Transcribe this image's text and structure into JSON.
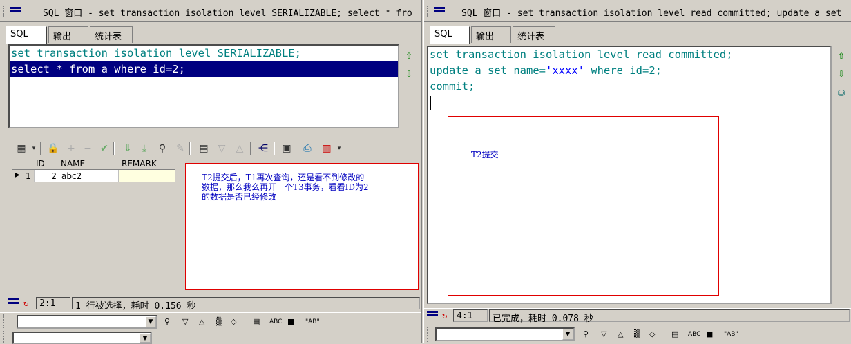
{
  "left": {
    "title": "SQL 窗口 - set transaction isolation level SERIALIZABLE; select * fro",
    "tabs": [
      "SQL",
      "输出",
      "统计表"
    ],
    "sql_lines": [
      {
        "kw1": "set transaction isolation level",
        "rest": " SERIALIZABLE;"
      },
      {
        "text": "select * from a where id=2;"
      }
    ],
    "grid": {
      "columns": [
        "ID",
        "NAME",
        "REMARK"
      ],
      "rows": [
        {
          "rownum": "1",
          "id": "2",
          "name": "abc2",
          "remark": ""
        }
      ]
    },
    "note": [
      "T2提交后，T1再次查询，还是看不到修改的",
      "数据，那么我么再开一个T3事务，看看ID为2",
      "的数据是否已经修改"
    ],
    "status": {
      "position": "2:1",
      "message": "1 行被选择，耗时 0.156 秒"
    }
  },
  "right": {
    "title": "SQL 窗口 - set transaction isolation level read committed; update a set",
    "tabs": [
      "SQL",
      "输出",
      "统计表"
    ],
    "sql_lines": [
      {
        "kw": "set transaction isolation level read committed",
        "rest": ";"
      },
      {
        "kw": "update",
        "mid": " a ",
        "kw2": "set",
        "mid2": " name=",
        "str": "'xxxx'",
        "mid3": " ",
        "kw3": "where",
        "rest": " id=2;"
      },
      {
        "kw": "commit",
        "rest": ";"
      }
    ],
    "note": "T2提交",
    "status": {
      "position": "4:1",
      "message": "已完成，耗时 0.078 秒"
    }
  },
  "findbar": {
    "abc": "ABC",
    "ab_quoted": "\"AB\""
  },
  "icons": {
    "toolbar": [
      "grid-icon",
      "lock-icon",
      "add-icon",
      "remove-icon",
      "check-icon",
      "next-icon",
      "last-icon",
      "find-icon",
      "clear-icon",
      "query-icon",
      "filter-down-icon",
      "filter-up-icon",
      "tree-icon",
      "save-icon",
      "print-icon",
      "chart-icon"
    ]
  }
}
